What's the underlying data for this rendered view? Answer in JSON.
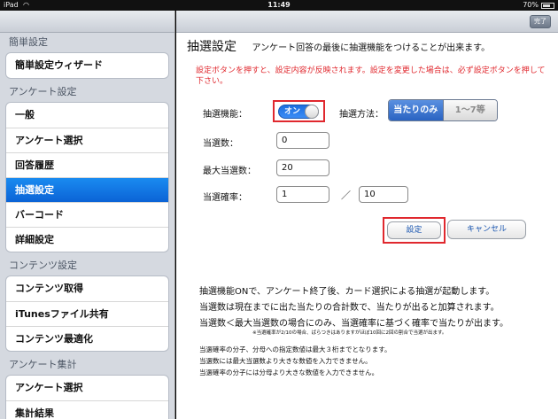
{
  "status_bar": {
    "carrier": "iPad",
    "time": "11:49",
    "battery": "70%",
    "battery_level": 0.7
  },
  "sidebar": {
    "sections": [
      {
        "header": "簡単設定",
        "items": [
          "簡単設定ウィザード"
        ]
      },
      {
        "header": "アンケート設定",
        "items": [
          "一般",
          "アンケート選択",
          "回答履歴",
          "抽選設定",
          "バーコード",
          "詳細設定"
        ]
      },
      {
        "header": "コンテンツ設定",
        "items": [
          "コンテンツ取得",
          "iTunesファイル共有",
          "コンテンツ最適化"
        ]
      },
      {
        "header": "アンケート集計",
        "items": [
          "アンケート選択",
          "集計結果"
        ]
      }
    ],
    "selected": "抽選設定"
  },
  "main": {
    "done_label": "完了",
    "title": "抽選設定",
    "description": "アンケート回答の最後に抽選機能をつけることが出来ます。",
    "warning": "設定ボタンを押すと、設定内容が反映されます。設定を変更した場合は、必ず設定ボタンを押して下さい。",
    "lottery_label": "抽選機能：",
    "toggle_label": "オン",
    "method_label": "抽選方法：",
    "method_options": [
      "当たりのみ",
      "1〜7等"
    ],
    "winners_label": "当選数：",
    "winners_value": "0",
    "max_winners_label": "最大当選数：",
    "max_winners_value": "20",
    "rate_label": "当選確率：",
    "rate_numerator": "1",
    "rate_slash": "／",
    "rate_denominator": "10",
    "set_label": "設定",
    "cancel_label": "キャンセル",
    "info_lines": [
      "抽選機能ONで、アンケート終了後、カード選択による抽選が起動します。",
      "当選数は現在までに出た当たりの合計数で、当たりが出ると加算されます。",
      "当選数＜最大当選数の場合にのみ、当選確率に基づく確率で当たりが出ます。"
    ],
    "info_small": "※当選確率が2/10の場合、ばらつきはありますがほぼ10回に2回の割合で当選が出ます。",
    "notes": [
      "当選確率の分子、分母への指定数値は最大３桁までとなります。",
      "当選数には最大当選数より大きな数値を入力できません。",
      "当選確率の分子には分母より大きな数値を入力できません。"
    ]
  }
}
